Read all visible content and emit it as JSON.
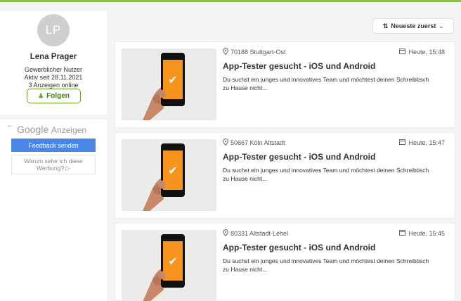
{
  "profile": {
    "initials": "LP",
    "name": "Lena Prager",
    "type": "Gewerblicher Nutzer",
    "active_since": "Aktiv seit 28.11.2021",
    "ads_online": "3 Anzeigen online",
    "follow_label": "Folgen"
  },
  "ads": {
    "brand_google": "Google",
    "brand_anzeigen": "Anzeigen",
    "feedback_label": "Feedback senden",
    "why_label": "Warum sehe ich diese Werbung?"
  },
  "sort": {
    "label": "Neueste zuerst"
  },
  "listings": [
    {
      "location": "70188 Stuttgart-Ost",
      "date": "Heute, 15:48",
      "title": "App-Tester gesucht - iOS und Android",
      "description": "Du suchst ein junges und innovatives Team und möchtest deinen Schreibtisch zu Hause nicht..."
    },
    {
      "location": "50667 Köln Altstadt",
      "date": "Heute, 15:47",
      "title": "App-Tester gesucht - iOS und Android",
      "description": "Du suchst ein junges und innovatives Team und möchtest deinen Schreibtisch zu Hause nicht..."
    },
    {
      "location": "80331 Altstadt-Lehel",
      "date": "Heute, 15:45",
      "title": "App-Tester gesucht - iOS und Android",
      "description": "Du suchst ein junges und innovatives Team und möchtest deinen Schreibtisch zu Hause nicht..."
    }
  ],
  "colors": {
    "accent_green": "#6aa329",
    "screen_orange": "#f7941d",
    "google_blue": "#4a86e8"
  }
}
